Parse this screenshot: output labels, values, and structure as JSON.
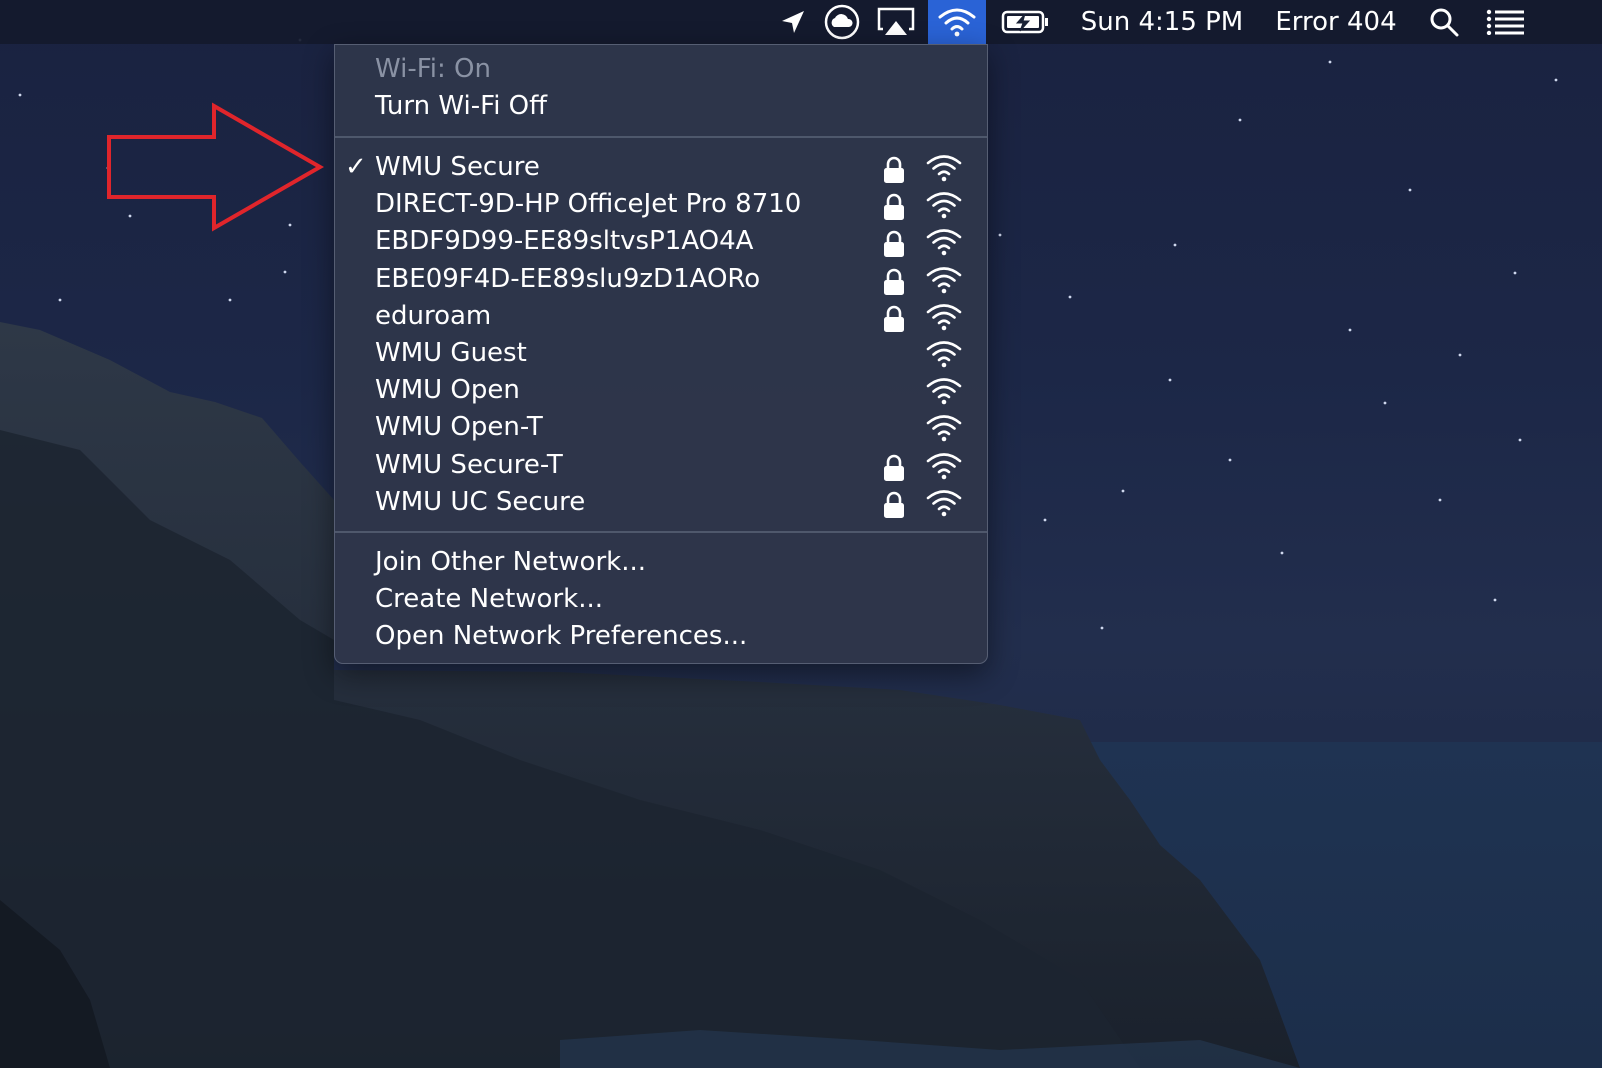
{
  "menubar": {
    "icons": [
      "location-arrow-icon",
      "cloud-sync-icon",
      "airplay-icon",
      "wifi-icon",
      "battery-charging-icon"
    ],
    "clock": "Sun 4:15 PM",
    "user": "Error 404",
    "search_icon": "search-icon",
    "notification_icon": "list-icon"
  },
  "wifi_menu": {
    "status": "Wi-Fi: On",
    "toggle": "Turn Wi-Fi Off",
    "networks": [
      {
        "name": "WMU Secure",
        "connected": true,
        "locked": true
      },
      {
        "name": "DIRECT-9D-HP OfficeJet Pro 8710",
        "connected": false,
        "locked": true
      },
      {
        "name": "EBDF9D99-EE89sltvsP1AO4A",
        "connected": false,
        "locked": true
      },
      {
        "name": "EBE09F4D-EE89slu9zD1AORo",
        "connected": false,
        "locked": true
      },
      {
        "name": "eduroam",
        "connected": false,
        "locked": true
      },
      {
        "name": "WMU Guest",
        "connected": false,
        "locked": false
      },
      {
        "name": "WMU Open",
        "connected": false,
        "locked": false
      },
      {
        "name": "WMU Open-T",
        "connected": false,
        "locked": false
      },
      {
        "name": "WMU Secure-T",
        "connected": false,
        "locked": true
      },
      {
        "name": "WMU UC Secure",
        "connected": false,
        "locked": true
      }
    ],
    "check_mark": "✓",
    "actions": [
      "Join Other Network...",
      "Create Network...",
      "Open Network Preferences..."
    ]
  },
  "annotation": {
    "type": "arrow",
    "color": "#e0252b"
  }
}
